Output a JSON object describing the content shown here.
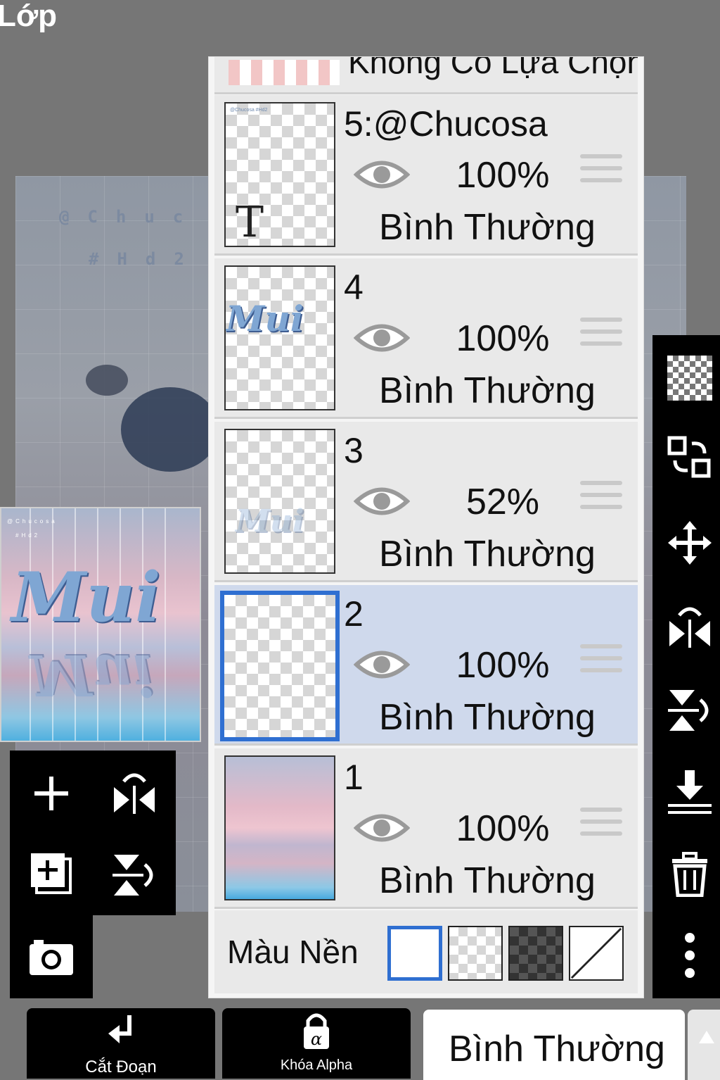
{
  "app": {
    "title": "Lớp"
  },
  "canvas": {
    "line1": "@Chuc",
    "line2": "#Hd2"
  },
  "preview": {
    "art_text": "Mui",
    "header_line1": "@Chucosa",
    "header_line2": "#Hd2"
  },
  "layers": {
    "top_partial": {
      "name": "Không Có Lựa Chọn"
    },
    "items": [
      {
        "name": "5:@Chucosa",
        "opacity": "100%",
        "blend": "Bình Thường",
        "thumb_char": "T",
        "thumb_art": "@Chucosa #Hd2"
      },
      {
        "name": "4",
        "opacity": "100%",
        "blend": "Bình Thường",
        "thumb_art": "Mui"
      },
      {
        "name": "3",
        "opacity": "52%",
        "blend": "Bình Thường",
        "thumb_art": "Mui"
      },
      {
        "name": "2",
        "opacity": "100%",
        "blend": "Bình Thường"
      },
      {
        "name": "1",
        "opacity": "100%",
        "blend": "Bình Thường"
      }
    ],
    "selected_index": 3
  },
  "background": {
    "label": "Màu Nền",
    "swatches": [
      "white",
      "checker-light",
      "checker-dark",
      "none"
    ]
  },
  "bottom": {
    "cut_label": "Cắt Đoạn",
    "alpha_lock_label": "Khóa Alpha",
    "blend_mode": "Bình Thường"
  },
  "colors": {
    "selected_row": "#cfd9ec",
    "selected_border": "#2f6fd1",
    "toolbar": "#000000",
    "panel": "#f5f5f5"
  }
}
